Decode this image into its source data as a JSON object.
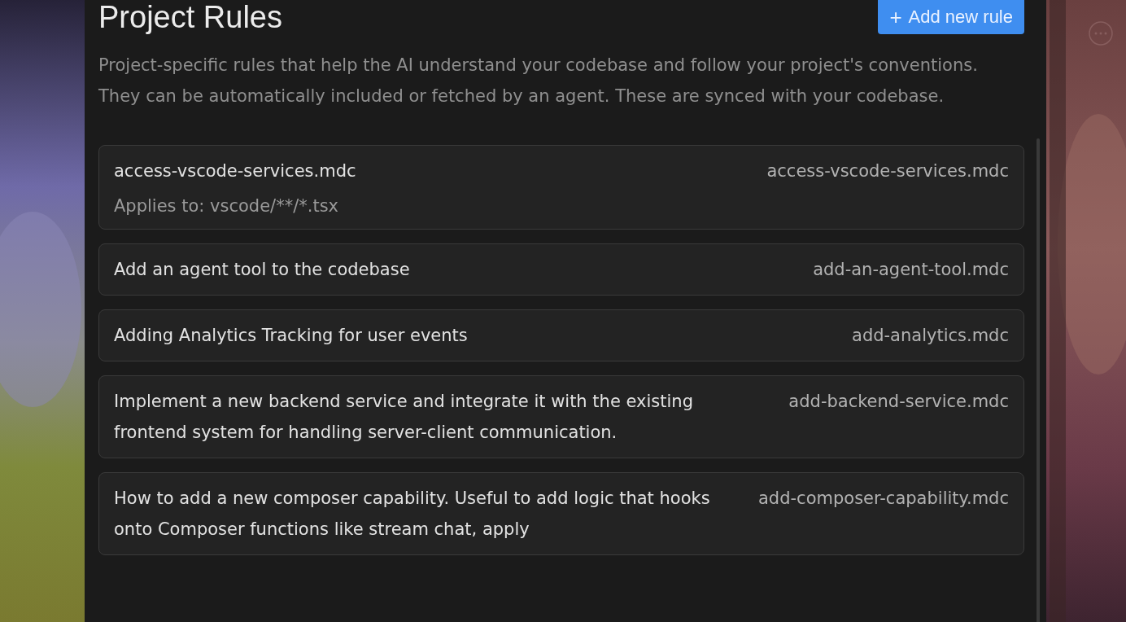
{
  "header": {
    "title": "Project Rules",
    "add_button": {
      "icon": "+",
      "label": "Add new rule"
    },
    "description": "Project-specific rules that help the AI understand your codebase and follow your project's conventions. They can be automatically included or fetched by an agent. These are synced with your codebase."
  },
  "rules": [
    {
      "description": "access-vscode-services.mdc",
      "applies_to": "Applies to: vscode/**/*.tsx",
      "filename": "access-vscode-services.mdc"
    },
    {
      "description": "Add an agent tool to the codebase",
      "filename": "add-an-agent-tool.mdc"
    },
    {
      "description": "Adding Analytics Tracking for user events",
      "filename": "add-analytics.mdc"
    },
    {
      "description": "Implement a new backend service and integrate it with the existing frontend system for handling server-client communication.",
      "filename": "add-backend-service.mdc"
    },
    {
      "description": "How to add a new composer capability. Useful to add logic that hooks onto Composer functions like stream chat, apply",
      "filename": "add-composer-capability.mdc"
    }
  ]
}
